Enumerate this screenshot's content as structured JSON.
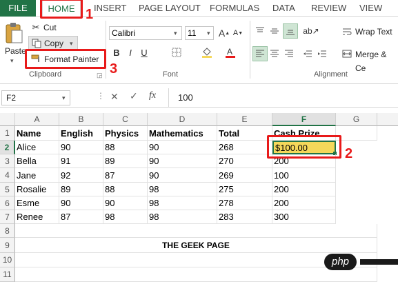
{
  "tabs": [
    "FILE",
    "HOME",
    "INSERT",
    "PAGE LAYOUT",
    "FORMULAS",
    "DATA",
    "REVIEW",
    "VIEW"
  ],
  "clipboard": {
    "cut": "Cut",
    "copy": "Copy",
    "paste": "Paste",
    "format_painter": "Format Painter",
    "label": "Clipboard"
  },
  "font": {
    "name": "Calibri",
    "size": "11",
    "label": "Font",
    "fill_color": "#f5d85a",
    "font_color": "#e81a1a"
  },
  "alignment": {
    "wrap_text": "Wrap Text",
    "merge": "Merge & Ce",
    "label": "Alignment"
  },
  "formula_bar": {
    "name_box": "F2",
    "fx": "fx",
    "value": "100"
  },
  "columns": [
    "A",
    "B",
    "C",
    "D",
    "E",
    "F",
    "G"
  ],
  "rows": [
    "1",
    "2",
    "3",
    "4",
    "5",
    "6",
    "7",
    "8",
    "9",
    "10",
    "11"
  ],
  "header": [
    "Name",
    "English",
    "Physics",
    "Mathematics",
    "Total",
    "Cash Prize"
  ],
  "data": [
    [
      "Alice",
      "90",
      "88",
      "90",
      "268",
      "$100.00"
    ],
    [
      "Bella",
      "91",
      "89",
      "90",
      "270",
      "200"
    ],
    [
      "Jane",
      "92",
      "87",
      "90",
      "269",
      "100"
    ],
    [
      "Rosalie",
      "89",
      "88",
      "98",
      "275",
      "200"
    ],
    [
      "Esme",
      "90",
      "90",
      "98",
      "278",
      "200"
    ],
    [
      "Renee",
      "87",
      "98",
      "98",
      "283",
      "300"
    ]
  ],
  "footer_text": "THE GEEK PAGE",
  "annotations": [
    "1",
    "2",
    "3"
  ],
  "watermark": "php",
  "colors": {
    "excel_green": "#217346",
    "selected_cell_fill": "#f5d85a",
    "annotation_red": "#e81a1a"
  }
}
